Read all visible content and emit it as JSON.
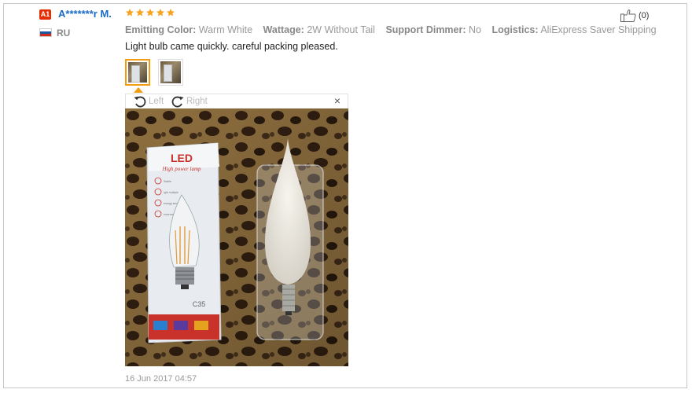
{
  "review": {
    "badge": "A1",
    "username": "A*******r M.",
    "rating": 5,
    "country": "RU",
    "attributes": [
      {
        "key": "Emitting Color:",
        "value": "Warm White"
      },
      {
        "key": "Wattage:",
        "value": "2W Without Tail"
      },
      {
        "key": "Support Dimmer:",
        "value": "No"
      },
      {
        "key": "Logistics:",
        "value": "AliExpress Saver Shipping"
      }
    ],
    "helpful_count": "(0)",
    "text": "Light bulb came quickly. careful packing pleased.",
    "timestamp": "16 Jun 2017 04:57"
  },
  "viewer": {
    "rotate_left_label": "Left",
    "rotate_right_label": "Right",
    "close_glyph": "×"
  },
  "photo": {
    "box_brand": "LED",
    "box_subtitle": "High power lamp",
    "box_model": "C35",
    "box_features": [
      "Stable",
      "Ight multiple",
      "energy saving",
      "environmental"
    ]
  },
  "colors": {
    "accent": "#f39c12",
    "username": "#1a6bc4",
    "badge": "#e62e04",
    "star": "#f7a31c"
  },
  "icons": {
    "helpful": "thumbs-up-icon",
    "rotate_left": "rotate-left-icon",
    "rotate_right": "rotate-right-icon",
    "close": "close-icon",
    "flag": "russia-flag-icon",
    "star": "star-icon"
  }
}
